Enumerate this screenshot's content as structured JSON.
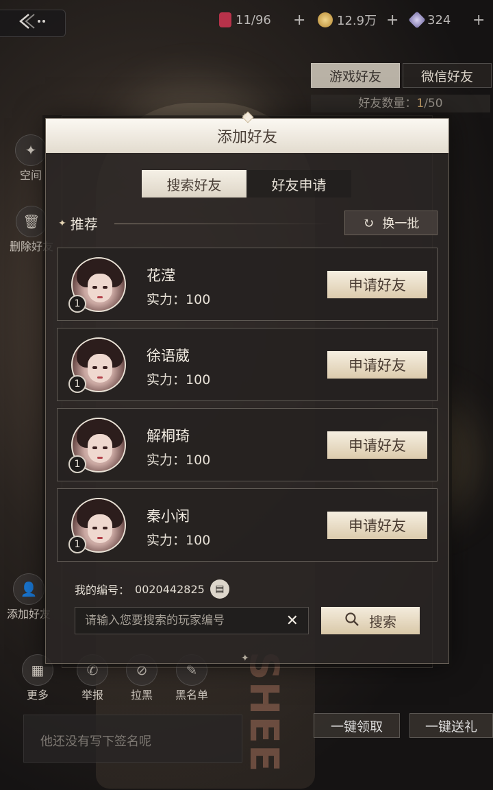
{
  "top_bar": {
    "back_icon": "back-arrow-icon",
    "resources": [
      {
        "name": "stamina",
        "icon": "drink-icon",
        "value": "11/96",
        "color": "#b8324a"
      },
      {
        "name": "gold",
        "icon": "coin-icon",
        "value": "12.9万",
        "color": "#c9a04a"
      },
      {
        "name": "diamond",
        "icon": "diamond-icon",
        "value": "324",
        "color": "#8d86b8"
      }
    ],
    "plus_label": "+"
  },
  "background_panel": {
    "tabs": [
      "游戏好友",
      "微信好友"
    ],
    "friend_count_label": "好友数量：",
    "friend_count_current": "1",
    "friend_count_total": "/50",
    "side_items": [
      {
        "label": "空间",
        "icon": "star-icon"
      },
      {
        "label": "删除好友",
        "icon": "trash-icon"
      },
      {
        "label": "添加好友",
        "icon": "add-friend-icon"
      },
      {
        "label": "更多",
        "icon": "grid-icon"
      },
      {
        "label": "举报",
        "icon": "phone-icon"
      },
      {
        "label": "拉黑",
        "icon": "block-icon"
      },
      {
        "label": "黑名单",
        "icon": "blacklist-icon"
      }
    ],
    "signature_placeholder": "他还没有写下签名呢",
    "bottom_buttons": [
      "一键领取",
      "一键送礼"
    ],
    "bg_text": "SHEE"
  },
  "modal": {
    "title": "添加好友",
    "tabs": [
      {
        "label": "搜索好友",
        "active": true
      },
      {
        "label": "好友申请",
        "active": false
      }
    ],
    "recommend_label": "推荐",
    "refresh_label": "换一批",
    "recommendations": [
      {
        "name": "花滢",
        "power_label": "实力：",
        "power": "100",
        "level": "1",
        "button": "申请好友"
      },
      {
        "name": "徐语葳",
        "power_label": "实力：",
        "power": "100",
        "level": "1",
        "button": "申请好友"
      },
      {
        "name": "解桐琦",
        "power_label": "实力：",
        "power": "100",
        "level": "1",
        "button": "申请好友"
      },
      {
        "name": "秦小闲",
        "power_label": "实力：",
        "power": "100",
        "level": "1",
        "button": "申请好友"
      }
    ],
    "my_id_label": "我的编号：",
    "my_id": "0020442825",
    "search_placeholder": "请输入您要搜索的玩家编号",
    "search_value": "",
    "search_button": "搜索"
  },
  "colors": {
    "accent": "#dccbad",
    "power_highlight": "#c9a36b",
    "header_bg": "#f2ece2"
  }
}
